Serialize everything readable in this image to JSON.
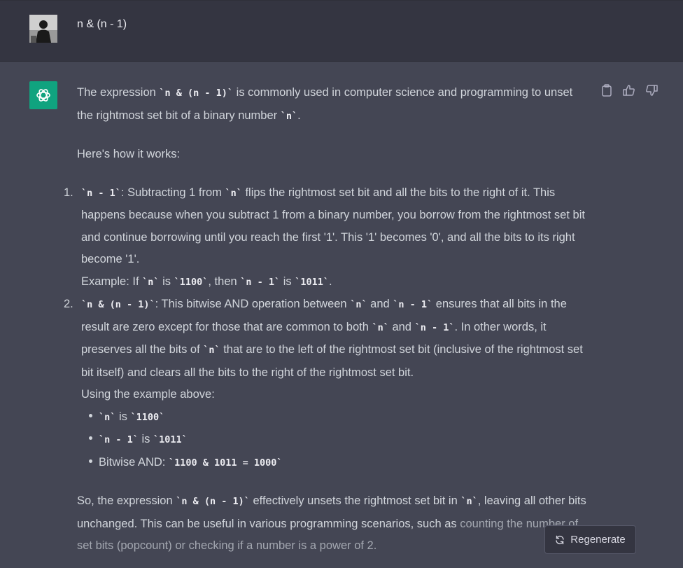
{
  "user": {
    "avatar": "user-photo-avatar",
    "message": "n & (n - 1)"
  },
  "assistant": {
    "avatar_icon": "openai-logo-icon",
    "brand_color": "#10a37f",
    "actions": [
      "copy-icon",
      "thumbs-up-icon",
      "thumbs-down-icon"
    ],
    "p1": {
      "t1": "The expression ",
      "c1": "`n & (n - 1)`",
      "t2": " is commonly used in computer science and programming to unset the rightmost set bit of a binary number ",
      "c2": "`n`",
      "t3": "."
    },
    "p2": "Here's how it works:",
    "item1": {
      "num": "1.",
      "c1": "`n - 1`",
      "t1": ": Subtracting 1 from ",
      "c2": "`n`",
      "t2": " flips the rightmost set bit and all the bits to the right of it. This happens because when you subtract 1 from a binary number, you borrow from the rightmost set bit and continue borrowing until you reach the first '1'. This '1' becomes '0', and all the bits to its right become '1'.",
      "ex_t1": "Example: If ",
      "ex_c1": "`n`",
      "ex_t2": " is ",
      "ex_c2": "`1100`",
      "ex_t3": ", then ",
      "ex_c3": "`n - 1`",
      "ex_t4": " is ",
      "ex_c4": "`1011`",
      "ex_t5": "."
    },
    "item2": {
      "num": "2.",
      "c1": "`n & (n - 1)`",
      "t1": ": This bitwise AND operation between ",
      "c2": "`n`",
      "t2": " and ",
      "c3": "`n - 1`",
      "t3": " ensures that all bits in the result are zero except for those that are common to both ",
      "c4": "`n`",
      "t4": " and ",
      "c5": "`n - 1`",
      "t5": ". In other words, it preserves all the bits of ",
      "c6": "`n`",
      "t6": " that are to the left of the rightmost set bit (inclusive of the rightmost set bit itself) and clears all the bits to the right of the rightmost set bit.",
      "using": "Using the example above:",
      "b1_c1": "`n`",
      "b1_t1": " is ",
      "b1_c2": "`1100`",
      "b2_c1": "`n - 1`",
      "b2_t1": " is ",
      "b2_c2": "`1011`",
      "b3_t1": "Bitwise AND: ",
      "b3_c1": "`1100 & 1011 = 1000`"
    },
    "p3": {
      "t1": "So, the expression ",
      "c1": "`n & (n - 1)`",
      "t2": " effectively unsets the rightmost set bit in ",
      "c2": "`n`",
      "t3": ", leaving all other bits unchanged. This can be useful in various programming scenarios, such as ",
      "t4": "counting the number of set bits (popcount) or checking if a number is a power of 2."
    }
  },
  "regenerate": {
    "label": "Regenerate",
    "icon": "refresh-icon"
  }
}
